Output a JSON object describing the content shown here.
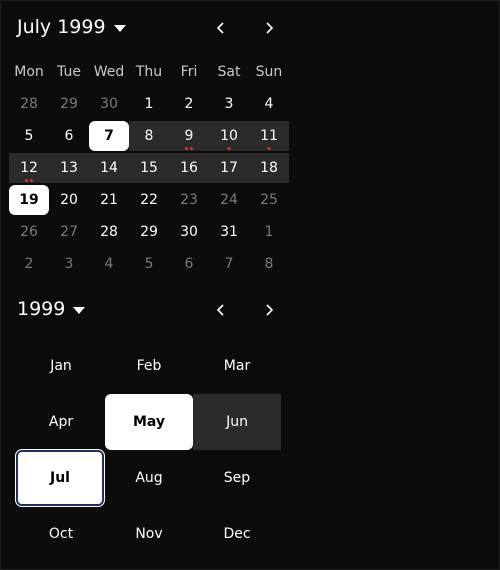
{
  "calendar": {
    "title": "July 1999",
    "weekdays": [
      "Mon",
      "Tue",
      "Wed",
      "Thu",
      "Fri",
      "Sat",
      "Sun"
    ],
    "weeks": [
      [
        {
          "d": "28",
          "dim": true
        },
        {
          "d": "29",
          "dim": true
        },
        {
          "d": "30",
          "dim": true
        },
        {
          "d": "1"
        },
        {
          "d": "2"
        },
        {
          "d": "3"
        },
        {
          "d": "4"
        }
      ],
      [
        {
          "d": "5"
        },
        {
          "d": "6"
        },
        {
          "d": "7",
          "sel": true
        },
        {
          "d": "8",
          "range": true
        },
        {
          "d": "9",
          "range": true,
          "dots": 2
        },
        {
          "d": "10",
          "range": true,
          "dots": 1
        },
        {
          "d": "11",
          "range": true,
          "dots": 1
        }
      ],
      [
        {
          "d": "12",
          "range": true,
          "dots": 2
        },
        {
          "d": "13",
          "range": true
        },
        {
          "d": "14",
          "range": true
        },
        {
          "d": "15",
          "range": true
        },
        {
          "d": "16",
          "range": true
        },
        {
          "d": "17",
          "range": true
        },
        {
          "d": "18",
          "range": true
        }
      ],
      [
        {
          "d": "19",
          "sel": true
        },
        {
          "d": "20"
        },
        {
          "d": "21"
        },
        {
          "d": "22"
        },
        {
          "d": "23",
          "dim": true
        },
        {
          "d": "24",
          "dim": true
        },
        {
          "d": "25",
          "dim": true
        }
      ],
      [
        {
          "d": "26",
          "dim": true
        },
        {
          "d": "27",
          "dim": true
        },
        {
          "d": "28"
        },
        {
          "d": "29"
        },
        {
          "d": "30"
        },
        {
          "d": "31"
        },
        {
          "d": "1",
          "dim": true
        }
      ],
      [
        {
          "d": "2",
          "dim": true
        },
        {
          "d": "3",
          "dim": true
        },
        {
          "d": "4",
          "dim": true
        },
        {
          "d": "5",
          "dim": true
        },
        {
          "d": "6",
          "dim": true
        },
        {
          "d": "7",
          "dim": true
        },
        {
          "d": "8",
          "dim": true
        }
      ]
    ]
  },
  "months": {
    "title": "1999",
    "items": [
      {
        "m": "Jan"
      },
      {
        "m": "Feb"
      },
      {
        "m": "Mar"
      },
      {
        "m": "Apr"
      },
      {
        "m": "May",
        "sel": true
      },
      {
        "m": "Jun",
        "range": true
      },
      {
        "m": "Jul",
        "focused": true
      },
      {
        "m": "Aug"
      },
      {
        "m": "Sep"
      },
      {
        "m": "Oct"
      },
      {
        "m": "Nov"
      },
      {
        "m": "Dec"
      }
    ]
  },
  "colors": {
    "background": "#0c0c0c",
    "range": "#2b2b2b",
    "selected": "#ffffff",
    "dot": "#e0302a",
    "focus_ring": "#1d2f63"
  }
}
